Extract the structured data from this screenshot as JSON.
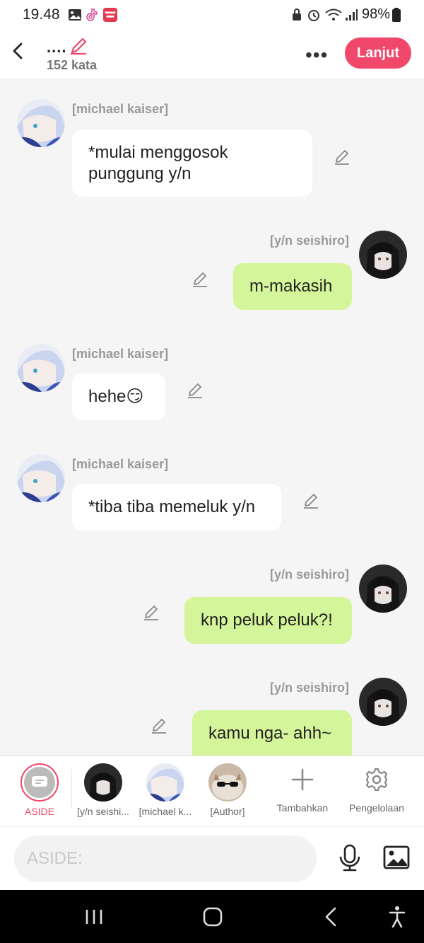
{
  "status_bar": {
    "time": "19.48",
    "battery": "98%",
    "icons": [
      "image-icon",
      "tiktok-icon",
      "mangatoon-icon",
      "lock-icon",
      "alarm-icon",
      "wifi-icon",
      "signal-icon",
      "battery-icon"
    ]
  },
  "header": {
    "title": "....",
    "word_count": "152 kata",
    "more_label": "•••",
    "next_label": "Lanjut"
  },
  "messages": [
    {
      "side": "left",
      "name": "[michael kaiser]",
      "text": "*mulai menggosok punggung y/n"
    },
    {
      "side": "right",
      "name": "[y/n seishiro]",
      "text": "m-makasih"
    },
    {
      "side": "left",
      "name": "[michael kaiser]",
      "text": "hehe😏"
    },
    {
      "side": "left",
      "name": "[michael kaiser]",
      "text": "*tiba tiba memeluk y/n"
    },
    {
      "side": "right",
      "name": "[y/n seishiro]",
      "text": "knp peluk peluk?!"
    },
    {
      "side": "right",
      "name": "[y/n seishiro]",
      "text": "kamu nga- ahh~"
    }
  ],
  "toolbar": {
    "aside_label": "ASIDE",
    "characters": [
      {
        "label": "[y/n seishi..."
      },
      {
        "label": "[michael k..."
      },
      {
        "label": "[Author]"
      }
    ],
    "add_label": "Tambahkan",
    "manage_label": "Pengelolaan"
  },
  "input": {
    "placeholder": "ASIDE:"
  },
  "colors": {
    "accent": "#f0476b",
    "right_bubble": "#d4f59a",
    "left_bubble": "#ffffff",
    "background": "#f5f5f5"
  }
}
